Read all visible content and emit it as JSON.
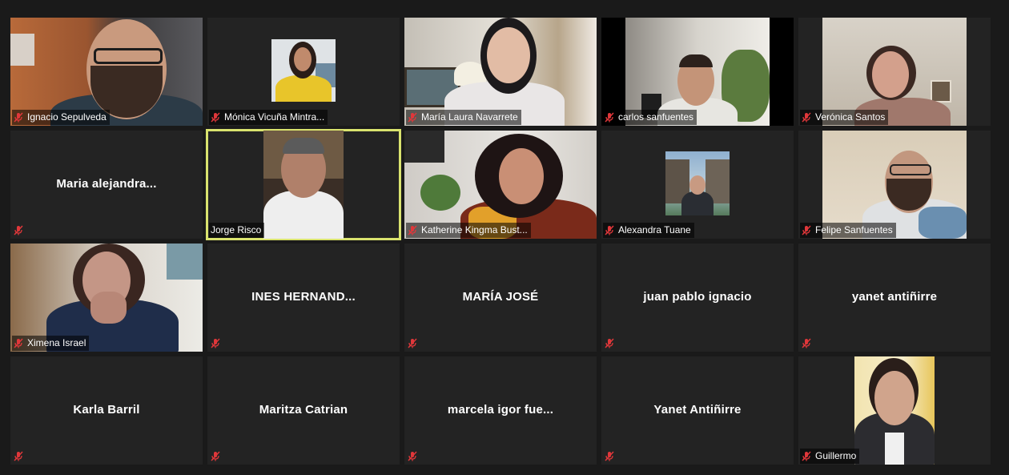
{
  "app": {
    "view": "gallery",
    "active_speaker_color": "#d9e36e",
    "muted_icon_color": "#e0373a"
  },
  "participants": [
    {
      "name": "Ignacio Sepulveda",
      "video": true,
      "muted": true
    },
    {
      "name": "Mónica Vicuña Mintra...",
      "video": true,
      "muted": true
    },
    {
      "name": "María Laura Navarrete",
      "video": true,
      "muted": true
    },
    {
      "name": "carlos sanfuentes",
      "video": true,
      "muted": true
    },
    {
      "name": "Verónica Santos",
      "video": true,
      "muted": true
    },
    {
      "name": "Maria  alejandra...",
      "video": false,
      "muted": true
    },
    {
      "name": "Jorge Risco",
      "video": true,
      "muted": false,
      "active_speaker": true
    },
    {
      "name": "Katherine Kingma Bust...",
      "video": true,
      "muted": true
    },
    {
      "name": "Alexandra Tuane",
      "video": true,
      "muted": true
    },
    {
      "name": "Felipe Sanfuentes",
      "video": true,
      "muted": true
    },
    {
      "name": "Ximena Israel",
      "video": true,
      "muted": true
    },
    {
      "name": "INES  HERNAND...",
      "video": false,
      "muted": true
    },
    {
      "name": "MARÍA JOSÉ",
      "video": false,
      "muted": true
    },
    {
      "name": "juan pablo ignacio",
      "video": false,
      "muted": true
    },
    {
      "name": "yanet antiñirre",
      "video": false,
      "muted": true
    },
    {
      "name": "Karla Barril",
      "video": false,
      "muted": true
    },
    {
      "name": "Maritza Catrian",
      "video": false,
      "muted": true
    },
    {
      "name": "marcela  igor  fue...",
      "video": false,
      "muted": true
    },
    {
      "name": "Yanet Antiñirre",
      "video": false,
      "muted": true
    },
    {
      "name": "Guillermo",
      "video": true,
      "muted": true
    }
  ]
}
